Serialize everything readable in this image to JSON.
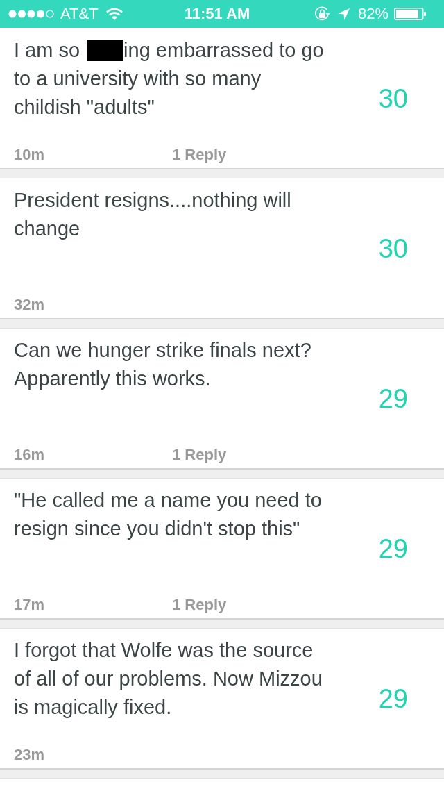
{
  "status_bar": {
    "carrier": "AT&T",
    "time": "11:51 AM",
    "battery": "82%"
  },
  "posts": [
    {
      "content": [
        {
          "kind": "text",
          "text": "I am so"
        },
        {
          "kind": "redaction"
        },
        {
          "kind": "text",
          "text": "ing embarrassed to go"
        },
        {
          "kind": "text",
          "text": "to a university with so many childish \"adults\""
        }
      ],
      "time": "10m",
      "replies": "1 Reply",
      "score": "30"
    },
    {
      "content": [
        {
          "kind": "text",
          "text": "President resigns....nothing will change"
        }
      ],
      "time": "32m",
      "score": "30"
    },
    {
      "content": [
        {
          "kind": "text",
          "text": "Can we hunger strike finals next? Apparently this works."
        }
      ],
      "time": "16m",
      "replies": "1 Reply",
      "score": "29"
    },
    {
      "content": [
        {
          "kind": "text",
          "text": "\"He called me a name you need to resign since you didn't stop this\""
        }
      ],
      "time": "17m",
      "replies": "1 Reply",
      "score": "29"
    },
    {
      "content": [
        {
          "kind": "text",
          "text": "I forgot that Wolfe was the source of all of our problems. Now Mizzou is magically fixed."
        }
      ],
      "time": "23m",
      "score": "29"
    }
  ]
}
